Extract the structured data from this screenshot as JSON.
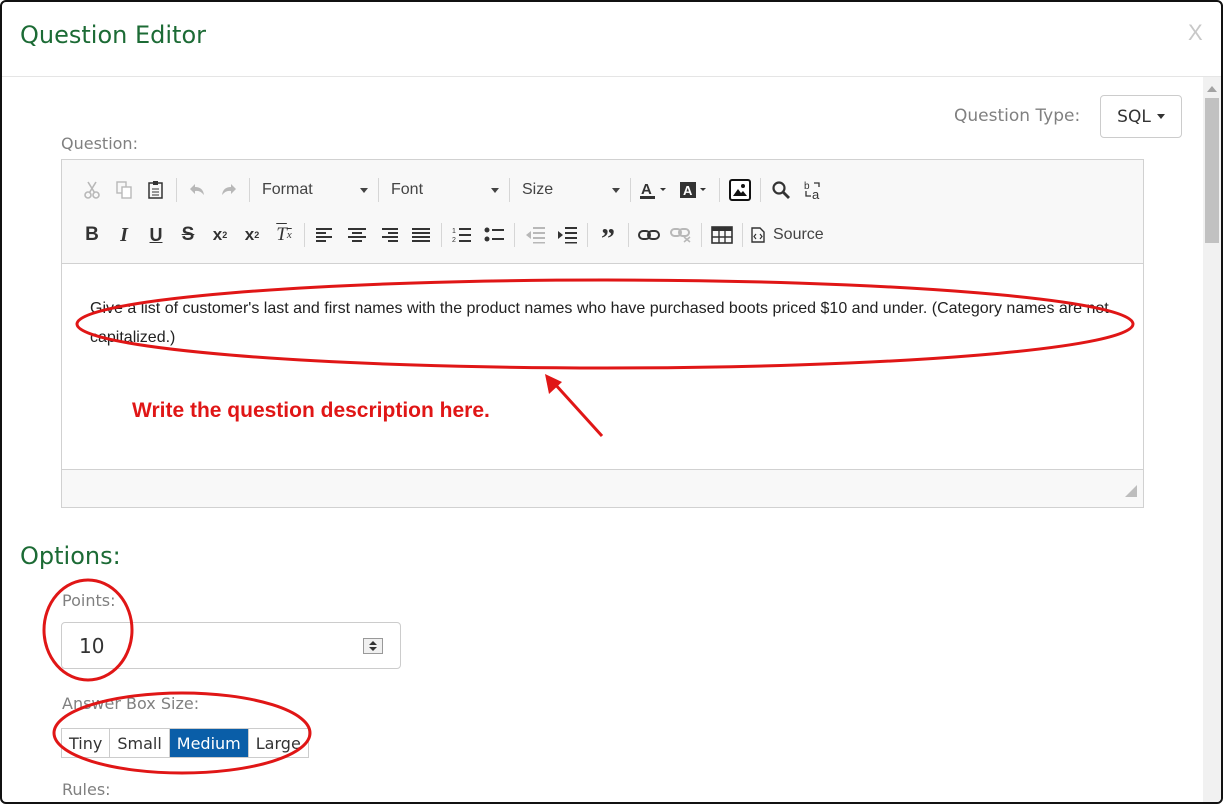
{
  "dialog": {
    "title": "Question Editor",
    "close_label": "X"
  },
  "question_type": {
    "label": "Question Type:",
    "selected": "SQL"
  },
  "question": {
    "label": "Question:",
    "toolbar": {
      "format_label": "Format",
      "font_label": "Font",
      "size_label": "Size",
      "source_label": "Source"
    },
    "content": "Give a list of customer's last and first names with the product names who have purchased boots priced $10 and under. (Category names are not capitalized.)"
  },
  "annotation": {
    "text": "Write the question description here.",
    "color": "#e01616"
  },
  "options": {
    "heading": "Options:",
    "points_label": "Points:",
    "points_value": "10",
    "answer_box_label": "Answer Box Size:",
    "answer_box_sizes": [
      "Tiny",
      "Small",
      "Medium",
      "Large"
    ],
    "answer_box_selected": "Medium",
    "rules_label": "Rules:"
  },
  "colors": {
    "title_green": "#1c6b35",
    "active_blue": "#0a5ea8",
    "annotation_red": "#e01616"
  }
}
